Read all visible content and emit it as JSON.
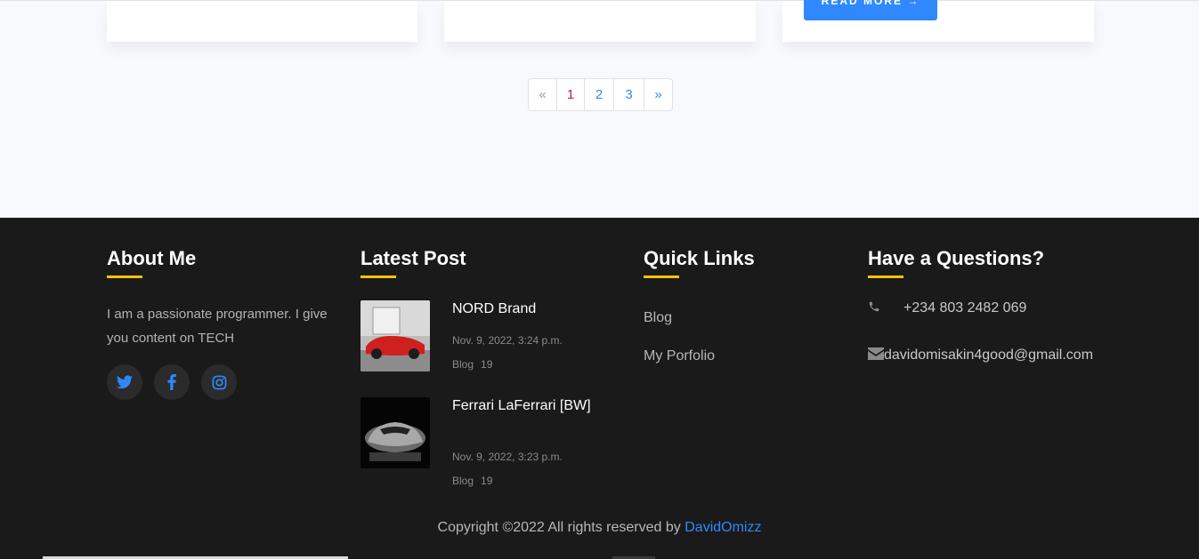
{
  "cards": {
    "read_more_label": "READ MORE →"
  },
  "pagination": {
    "prev": "«",
    "pages": [
      "1",
      "2",
      "3"
    ],
    "next": "»",
    "active_page": "1"
  },
  "footer": {
    "about": {
      "title": "About Me",
      "text": "I am a passionate programmer. I give you content on TECH",
      "social_icons": [
        "twitter-icon",
        "facebook-icon",
        "instagram-icon"
      ]
    },
    "latest": {
      "title": "Latest Post",
      "posts": [
        {
          "title": "NORD Brand",
          "date": "Nov. 9, 2022, 3:24 p.m.",
          "category": "Blog",
          "count": "19"
        },
        {
          "title": "Ferrari LaFerrari [BW]",
          "date": "Nov. 9, 2022, 3:23 p.m.",
          "category": "Blog",
          "count": "19"
        }
      ]
    },
    "quick_links": {
      "title": "Quick Links",
      "links": [
        "Blog",
        "My Porfolio"
      ]
    },
    "questions": {
      "title": "Have a Questions?",
      "phone": "+234 803 2482 069",
      "email": "davidomisakin4good@gmail.com"
    },
    "copyright": {
      "text": "Copyright ©2022 All rights reserved by",
      "author": "DavidOmizz"
    }
  },
  "colors": {
    "accent": "#2f89fc",
    "underline": "#ffc107",
    "footer_bg": "#1a1a1a",
    "active_page": "#c2185b"
  }
}
